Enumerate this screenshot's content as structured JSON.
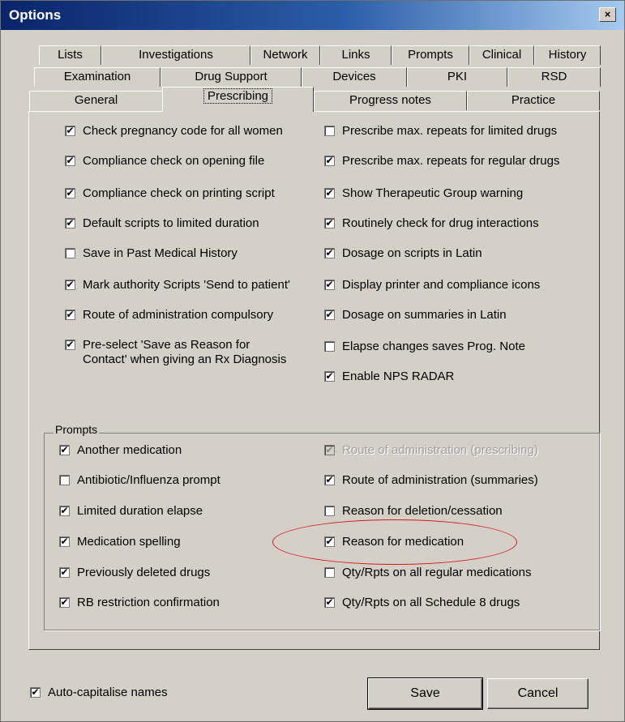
{
  "window": {
    "title": "Options",
    "close_glyph": "×"
  },
  "tabs": {
    "row1": [
      "Lists",
      "Investigations",
      "Network",
      "Links",
      "Prompts",
      "Clinical",
      "History"
    ],
    "row2": [
      "Examination",
      "Drug Support",
      "Devices",
      "PKI",
      "RSD"
    ],
    "row3": [
      "General",
      "Prescribing",
      "Progress notes",
      "Practice"
    ],
    "active": "Prescribing"
  },
  "prescribing": {
    "left": [
      {
        "label": "Check pregnancy code for all women",
        "checked": true
      },
      {
        "label": "Compliance check on opening file",
        "checked": true
      },
      {
        "label": "Compliance check on printing script",
        "checked": true
      },
      {
        "label": "Default scripts to limited duration",
        "checked": true
      },
      {
        "label": "Save in Past Medical History",
        "checked": false
      },
      {
        "label": "Mark authority Scripts 'Send to patient'",
        "checked": true
      },
      {
        "label": "Route of administration compulsory",
        "checked": true
      },
      {
        "label": "Pre-select 'Save as Reason for",
        "label2": "Contact' when giving an Rx Diagnosis",
        "checked": true
      }
    ],
    "right": [
      {
        "label": "Prescribe max. repeats for limited drugs",
        "checked": false
      },
      {
        "label": "Prescribe max. repeats for regular drugs",
        "checked": true
      },
      {
        "label": "Show Therapeutic Group warning",
        "checked": true
      },
      {
        "label": "Routinely check for drug interactions",
        "checked": true
      },
      {
        "label": "Dosage on scripts in Latin",
        "checked": true
      },
      {
        "label": "Display printer and compliance icons",
        "checked": true
      },
      {
        "label": "Dosage on summaries in Latin",
        "checked": true
      },
      {
        "label": "Elapse changes saves Prog. Note",
        "checked": false
      },
      {
        "label": "Enable NPS RADAR",
        "checked": true
      }
    ]
  },
  "prompts": {
    "legend": "Prompts",
    "left": [
      {
        "label": "Another medication",
        "checked": true
      },
      {
        "label": "Antibiotic/Influenza prompt",
        "checked": false
      },
      {
        "label": "Limited duration elapse",
        "checked": true
      },
      {
        "label": "Medication spelling",
        "checked": true
      },
      {
        "label": "Previously deleted drugs",
        "checked": true
      },
      {
        "label": "RB restriction confirmation",
        "checked": true
      }
    ],
    "right": [
      {
        "label": "Route of administration (prescribing)",
        "checked": true,
        "disabled": true
      },
      {
        "label": "Route of administration (summaries)",
        "checked": true
      },
      {
        "label": "Reason for deletion/cessation",
        "checked": false
      },
      {
        "label": "Reason for medication",
        "checked": true
      },
      {
        "label": "Qty/Rpts on all regular medications",
        "checked": false
      },
      {
        "label": "Qty/Rpts on all Schedule 8 drugs",
        "checked": true
      }
    ]
  },
  "footer": {
    "auto_capitalise": {
      "label": "Auto-capitalise names",
      "checked": true
    },
    "save_label": "Save",
    "cancel_label": "Cancel"
  },
  "check_glyph": "✔",
  "colors": {
    "title_start": "#0a246a",
    "title_end": "#a6caf0",
    "dialog_bg": "#d4d0c8",
    "annotation": "#d4191e"
  }
}
